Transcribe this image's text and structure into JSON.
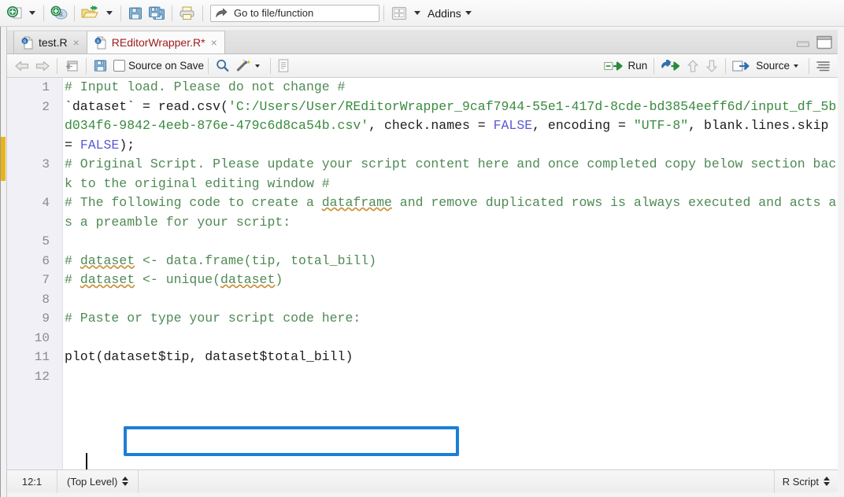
{
  "main_toolbar": {
    "new_file_icon": "new-file-icon",
    "new_file_dropdown_icon": "chevron-down-icon",
    "new_project_icon": "new-r-project-icon",
    "open_file_icon": "open-folder-icon",
    "open_file_dropdown_icon": "chevron-down-icon",
    "save_icon": "save-icon",
    "save_all_icon": "save-all-icon",
    "print_icon": "print-icon",
    "goto_icon": "goto-arrow-icon",
    "goto_placeholder": "Go to file/function",
    "goto_value": "",
    "panes_icon": "pane-layout-icon",
    "panes_dropdown_icon": "chevron-down-icon",
    "addins_label": "Addins",
    "addins_dropdown_icon": "chevron-down-icon"
  },
  "tabs": [
    {
      "label": "test.R",
      "icon": "r-script-file-icon",
      "close_icon": "×",
      "active": false
    },
    {
      "label": "REditorWrapper.R*",
      "icon": "r-script-file-icon",
      "close_icon": "×",
      "active": true
    }
  ],
  "pane_controls": {
    "minimize_icon": "minimize-pane-icon",
    "maximize_icon": "maximize-pane-icon"
  },
  "editor_toolbar": {
    "back_icon": "back-arrow-icon",
    "forward_icon": "forward-arrow-icon",
    "popout_icon": "show-in-new-window-icon",
    "save_icon": "save-icon",
    "source_on_save_label": "Source on Save",
    "source_on_save_checked": false,
    "find_icon": "search-icon",
    "magic_icon": "code-tools-wand-icon",
    "magic_dropdown_icon": "chevron-down-icon",
    "compile_report_icon": "compile-report-icon",
    "run_icon": "run-icon",
    "run_label": "Run",
    "rerun_icon": "rerun-previous-icon",
    "prev_chunk_icon": "up-arrow-icon",
    "next_chunk_icon": "down-arrow-icon",
    "source_icon": "source-icon",
    "source_label": "Source",
    "source_dropdown_icon": "chevron-down-icon",
    "outline_icon": "document-outline-icon"
  },
  "editor": {
    "lines": [
      {
        "number": "1",
        "segments": [
          {
            "text": "# Input load. Please do not change #",
            "cls": "cmt"
          }
        ]
      },
      {
        "number": "2",
        "segments": [
          {
            "text": "`dataset` = read.csv(",
            "cls": ""
          },
          {
            "text": "'C:/Users/User/REditorWrapper_9caf7944-55e1-417d-8cde-bd3854eeff6d/input_df_5bd034f6-9842-4eeb-876e-479c6d8ca54b.csv'",
            "cls": "str"
          },
          {
            "text": ", check.names = ",
            "cls": ""
          },
          {
            "text": "FALSE",
            "cls": "kw"
          },
          {
            "text": ", encoding = ",
            "cls": ""
          },
          {
            "text": "\"UTF-8\"",
            "cls": "str"
          },
          {
            "text": ", blank.lines.skip = ",
            "cls": ""
          },
          {
            "text": "FALSE",
            "cls": "kw"
          },
          {
            "text": ");",
            "cls": ""
          }
        ]
      },
      {
        "number": "3",
        "segments": [
          {
            "text": "# Original Script. Please update your script content here and once completed copy below section back to the original editing window #",
            "cls": "cmt"
          }
        ]
      },
      {
        "number": "4",
        "segments": [
          {
            "text": "# The following code to create a ",
            "cls": "cmt"
          },
          {
            "text": "dataframe",
            "cls": "cmt spell"
          },
          {
            "text": " and remove duplicated rows is always executed and acts as a preamble for your script:",
            "cls": "cmt"
          }
        ]
      },
      {
        "number": "5",
        "segments": [
          {
            "text": "",
            "cls": ""
          }
        ]
      },
      {
        "number": "6",
        "segments": [
          {
            "text": "# ",
            "cls": "cmt"
          },
          {
            "text": "dataset",
            "cls": "cmt spell"
          },
          {
            "text": " <- data.frame(tip, total_bill)",
            "cls": "cmt"
          }
        ]
      },
      {
        "number": "7",
        "segments": [
          {
            "text": "# ",
            "cls": "cmt"
          },
          {
            "text": "dataset",
            "cls": "cmt spell"
          },
          {
            "text": " <- unique(",
            "cls": "cmt"
          },
          {
            "text": "dataset",
            "cls": "cmt spell"
          },
          {
            "text": ")",
            "cls": "cmt"
          }
        ]
      },
      {
        "number": "8",
        "segments": [
          {
            "text": "",
            "cls": ""
          }
        ]
      },
      {
        "number": "9",
        "segments": [
          {
            "text": "# Paste or type your script code here:",
            "cls": "cmt"
          }
        ]
      },
      {
        "number": "10",
        "segments": [
          {
            "text": "",
            "cls": ""
          }
        ]
      },
      {
        "number": "11",
        "segments": [
          {
            "text": "plot(dataset$tip, dataset$total_bill)",
            "cls": ""
          }
        ]
      },
      {
        "number": "12",
        "segments": [
          {
            "text": "",
            "cls": ""
          }
        ]
      }
    ],
    "highlight_target": "plot(dataset$tip, dataset$total_bill)",
    "highlight_color": "#1c7ed6"
  },
  "statusbar": {
    "cursor_position": "12:1",
    "scope": "(Top Level)",
    "scope_picker_icon": "up-down-arrows-icon",
    "file_type": "R Script",
    "file_type_picker_icon": "up-down-arrows-icon"
  }
}
